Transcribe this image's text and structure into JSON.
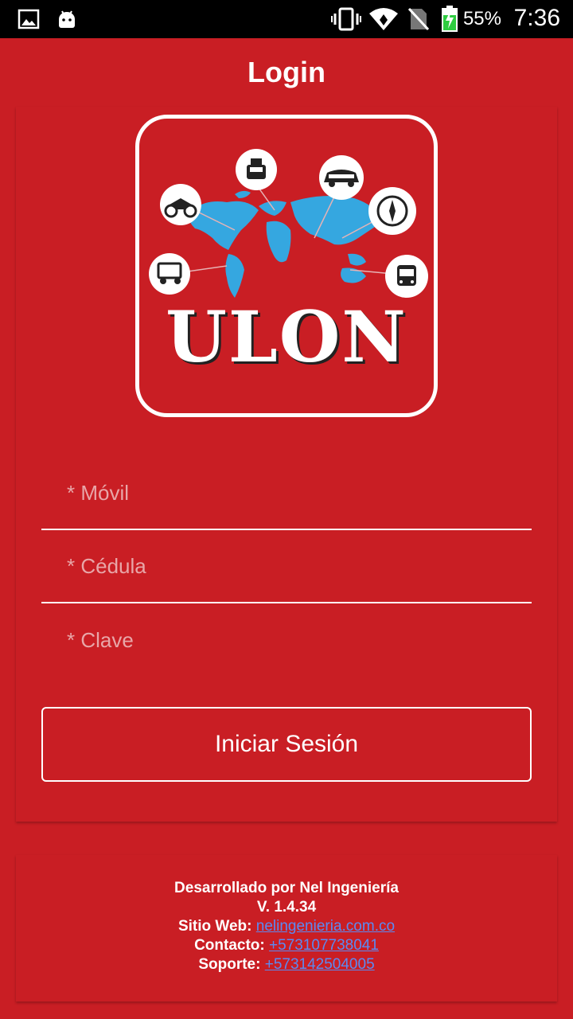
{
  "status_bar": {
    "battery_percent": "55%",
    "time": "7:36",
    "icons": [
      "image-icon",
      "android-icon",
      "vibrate-icon",
      "wifi-icon",
      "no-sim-icon",
      "battery-charging-icon"
    ]
  },
  "header": {
    "title": "Login"
  },
  "logo": {
    "text": "ULON",
    "icons": [
      "taxi-icon",
      "car-icon",
      "motorcycle-icon",
      "compass-icon",
      "tuktuk-icon",
      "bus-icon",
      "world-map-icon"
    ],
    "map_color": "#35a7e0"
  },
  "form": {
    "mobile_placeholder": "* Móvil",
    "id_placeholder": "* Cédula",
    "password_placeholder": "* Clave",
    "submit_label": "Iniciar Sesión"
  },
  "footer": {
    "developed_by": "Desarrollado por Nel Ingeniería",
    "version": "V. 1.4.34",
    "website_label": "Sitio Web:",
    "website_link": "nelingenieria.com.co",
    "contact_label": "Contacto:",
    "contact_link": "+573107738041",
    "support_label": "Soporte:",
    "support_link": "+573142504005"
  },
  "colors": {
    "background": "#c91e24",
    "link": "#5b8af2"
  }
}
